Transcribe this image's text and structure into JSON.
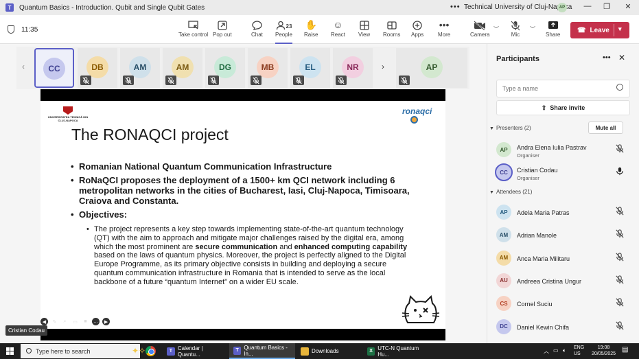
{
  "window": {
    "title": "Quantum Basics - Introduction. Qubit and Single Qubit Gates",
    "org": "Technical University of Cluj-Napoca",
    "org_initials": "AP"
  },
  "toolbar": {
    "time": "11:35",
    "buttons": {
      "take_control": "Take control",
      "pop_out": "Pop out",
      "chat": "Chat",
      "people": "People",
      "people_count": "23",
      "raise": "Raise",
      "react": "React",
      "view": "View",
      "rooms": "Rooms",
      "apps": "Apps",
      "more": "More",
      "camera": "Camera",
      "mic": "Mic",
      "share": "Share",
      "leave": "Leave"
    }
  },
  "gallery": {
    "tiles": [
      {
        "initials": "CC",
        "bg": "#c5c8ee",
        "fg": "#3d3f8f"
      },
      {
        "initials": "DB",
        "bg": "#f4dca8",
        "fg": "#8a5a00"
      },
      {
        "initials": "AM",
        "bg": "#cfe0ea",
        "fg": "#2a5069"
      },
      {
        "initials": "AM",
        "bg": "#f0e0b0",
        "fg": "#7a5a12"
      },
      {
        "initials": "DG",
        "bg": "#c8ead8",
        "fg": "#1f6a40"
      },
      {
        "initials": "MB",
        "bg": "#f7d2c3",
        "fg": "#8a3a1e"
      },
      {
        "initials": "EL",
        "bg": "#cde3f0",
        "fg": "#265c80"
      },
      {
        "initials": "NR",
        "bg": "#f2cfe0",
        "fg": "#8a2a5a"
      },
      {
        "initials": "AP",
        "bg": "#d3e8cf",
        "fg": "#375c31"
      }
    ]
  },
  "slide": {
    "uni_name": "UNIVERSITATEA TEHNICĂ DIN CLUJ-NAPOCA",
    "brand": "ronaqci",
    "title": "The RONAQCI project",
    "bullets": [
      "Romanian National Quantum Communication Infrastructure",
      "RoNaQCI proposes the deployment of a 1500+ km QCI network including 6 metropolitan networks in the cities of Bucharest, Iasi, Cluj-Napoca, Timisoara, Craiova and Constanta.",
      "Objectives:"
    ],
    "sub_part1": "The project represents a key step towards implementing state-of-the-art quantum technology (QT) with the aim to approach and mitigate major challenges raised by the digital era, among which the most prominent are ",
    "sub_bold1": "secure communication",
    "sub_part2": " and ",
    "sub_bold2": "enhanced computing capability",
    "sub_part3": " based on the laws of quantum physics. Moreover, the project is perfectly aligned to the Digital Europe Programme, as its primary objective consists in building and deploying a secure quantum communication infrastructure in Romania that is intended to serve as the local backbone of a future “quantum Internet” on a wider EU scale."
  },
  "presenter": "Cristian Codau",
  "panel": {
    "title": "Participants",
    "search_placeholder": "Type a name",
    "share_invite": "Share invite",
    "presenters_header": "Presenters (2)",
    "mute_all": "Mute all",
    "attendees_header": "Attendees (21)",
    "presenters": [
      {
        "initials": "AP",
        "name": "Andra Elena Iulia Pastrav",
        "role": "Organiser",
        "bg": "#d3e8cf",
        "fg": "#375c31",
        "muted": true
      },
      {
        "initials": "CC",
        "name": "Cristian Codau",
        "role": "Organiser",
        "bg": "#c5c8ee",
        "fg": "#3d3f8f",
        "muted": false
      }
    ],
    "attendees": [
      {
        "initials": "AP",
        "name": "Adela Maria Patras",
        "bg": "#cde3f0",
        "fg": "#265c80"
      },
      {
        "initials": "AM",
        "name": "Adrian Manole",
        "bg": "#cfe0ea",
        "fg": "#2a5069"
      },
      {
        "initials": "AM",
        "name": "Anca Maria Militaru",
        "bg": "#f4dca8",
        "fg": "#8a5a00"
      },
      {
        "initials": "AU",
        "name": "Andreea Cristina Ungur",
        "bg": "#f2d6d6",
        "fg": "#8a3030"
      },
      {
        "initials": "CS",
        "name": "Cornel Suciu",
        "bg": "#f7d2c3",
        "fg": "#b03a1e"
      },
      {
        "initials": "DC",
        "name": "Daniel Kewin Chifa",
        "bg": "#c5c8ee",
        "fg": "#3d3f8f"
      }
    ]
  },
  "taskbar": {
    "search_placeholder": "Type here to search",
    "tasks": [
      {
        "label": "Calendar | Quantu...",
        "icon": "teams-icon"
      },
      {
        "label": "Quantum Basics - In...",
        "icon": "teams-icon"
      },
      {
        "label": "Downloads",
        "icon": "folder-icon"
      },
      {
        "label": "UTC-N Quantum Hu...",
        "icon": "excel-icon"
      }
    ],
    "lang1": "ENG",
    "lang2": "US",
    "time": "19:08",
    "date": "20/05/2025"
  }
}
